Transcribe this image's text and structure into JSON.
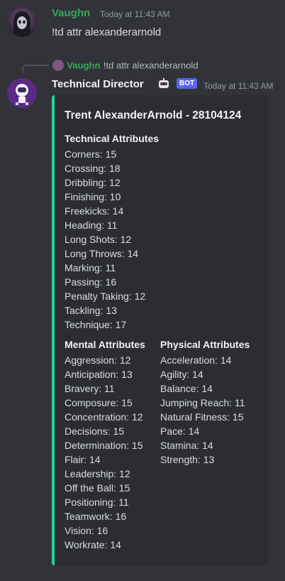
{
  "message1": {
    "author": "Vaughn",
    "timestamp": "Today at 11:43 AM",
    "text": "!td attr alexanderarnold",
    "author_color": "#3ba55c"
  },
  "reply": {
    "author": "Vaughn",
    "text": "!td attr alexanderarnold"
  },
  "message2": {
    "author": "Technical Director",
    "badge": "BOT",
    "timestamp": "Today at 11:43 AM",
    "embed": {
      "accent_color": "#23d4a4",
      "title": "Trent AlexanderArnold - 28104124",
      "technical": {
        "name": "Technical Attributes",
        "lines": [
          "Corners: 15",
          "Crossing: 18",
          "Dribbling: 12",
          "Finishing: 10",
          "Freekicks: 14",
          "Heading: 11",
          "Long Shots: 12",
          "Long Throws: 14",
          "Marking: 11",
          "Passing: 16",
          "Penalty Taking: 12",
          "Tackling: 13",
          "Technique: 17"
        ]
      },
      "mental": {
        "name": "Mental Attributes",
        "lines": [
          "Aggression: 12",
          "Anticipation: 13",
          "Bravery: 11",
          "Composure: 15",
          "Concentration: 12",
          "Decisions: 15",
          "Determination: 15",
          "Flair: 14",
          "Leadership: 12",
          "Off the Ball: 15",
          "Positioning: 11",
          "Teamwork: 16",
          "Vision: 16",
          "Workrate: 14"
        ]
      },
      "physical": {
        "name": "Physical Attributes",
        "lines": [
          "Acceleration: 14",
          "Agility: 14",
          "Balance: 14",
          "Jumping Reach: 11",
          "Natural Fitness: 15",
          "Pace: 14",
          "Stamina: 14",
          "Strength: 13"
        ]
      }
    }
  }
}
